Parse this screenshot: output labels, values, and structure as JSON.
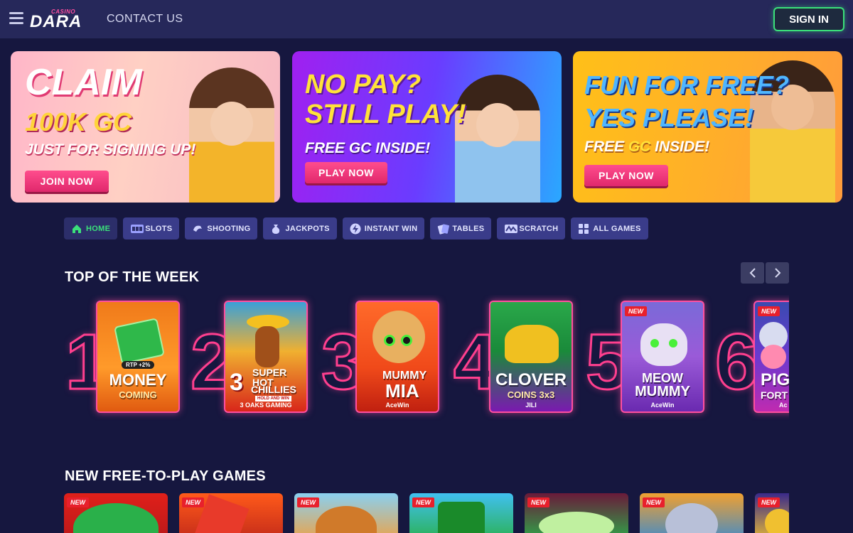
{
  "header": {
    "logo_small": "CASINO",
    "logo_main": "DARA",
    "contact_label": "CONTACT US",
    "signin_label": "SIGN IN"
  },
  "banners": [
    {
      "line1": "CLAIM",
      "line2": "100K GC",
      "line3": "JUST FOR SIGNING UP!",
      "button": "JOIN NOW"
    },
    {
      "line1": "NO PAY?",
      "line2": "STILL PLAY!",
      "line3": "FREE GC INSIDE!",
      "button": "PLAY NOW"
    },
    {
      "line1": "FUN FOR FREE?",
      "line2": "YES PLEASE!",
      "line3_pre": "FREE ",
      "line3_gc": "GC",
      "line3_post": " INSIDE!",
      "button": "PLAY NOW"
    }
  ],
  "categories": [
    {
      "label": "HOME",
      "icon": "home-icon"
    },
    {
      "label": "SLOTS",
      "icon": "slots-icon"
    },
    {
      "label": "SHOOTING",
      "icon": "shooting-icon"
    },
    {
      "label": "JACKPOTS",
      "icon": "jackpot-icon"
    },
    {
      "label": "INSTANT WIN",
      "icon": "lightning-icon"
    },
    {
      "label": "TABLES",
      "icon": "cards-icon"
    },
    {
      "label": "SCRATCH",
      "icon": "scratch-icon"
    },
    {
      "label": "ALL GAMES",
      "icon": "grid-icon"
    }
  ],
  "top_week": {
    "title": "TOP OF THE WEEK",
    "games": [
      {
        "rank": "1",
        "name1": "MONEY",
        "name2": "COMING",
        "badge": "RTP +2%",
        "provider": "",
        "is_new": false
      },
      {
        "rank": "2",
        "name1": "SUPER HOT",
        "name2": "CHILLIES",
        "badge": "HOLD AND WIN",
        "provider": "3 OAKS GAMING",
        "is_new": false
      },
      {
        "rank": "3",
        "name1": "MUMMY",
        "name2": "MIA",
        "badge": "",
        "provider": "AceWin",
        "is_new": false
      },
      {
        "rank": "4",
        "name1": "CLOVER",
        "name2": "COINS 3x3",
        "badge": "",
        "provider": "JILI",
        "is_new": false
      },
      {
        "rank": "5",
        "name1": "MEOW",
        "name2": "MUMMY",
        "badge": "NEW",
        "provider": "AceWin",
        "is_new": true
      },
      {
        "rank": "6",
        "name1": "PIG",
        "name2": "FORT",
        "badge": "NEW",
        "provider": "Ac",
        "is_new": true
      }
    ]
  },
  "new_games": {
    "title": "NEW FREE-TO-PLAY GAMES",
    "badge": "NEW",
    "count_visible": 7
  }
}
